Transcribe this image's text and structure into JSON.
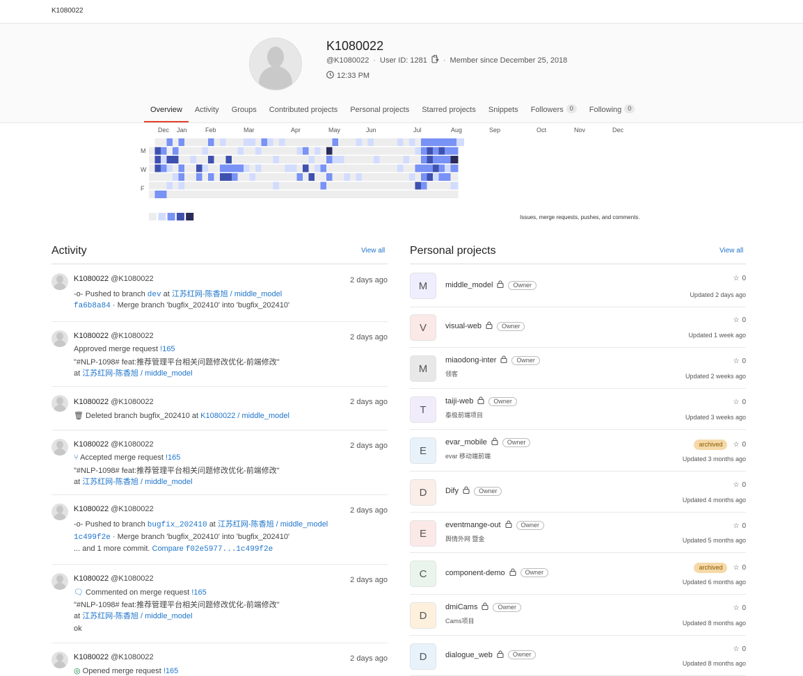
{
  "topbar": {
    "crumb": "K1080022"
  },
  "profile": {
    "name": "K1080022",
    "handle": "@K1080022",
    "user_id": "User ID: 1281",
    "member_since": "Member since December 25, 2018",
    "local_time": "12:33 PM"
  },
  "tabs": [
    {
      "label": "Overview"
    },
    {
      "label": "Activity"
    },
    {
      "label": "Groups"
    },
    {
      "label": "Contributed projects"
    },
    {
      "label": "Personal projects"
    },
    {
      "label": "Starred projects"
    },
    {
      "label": "Snippets"
    },
    {
      "label": "Followers",
      "count": "0"
    },
    {
      "label": "Following",
      "count": "0"
    }
  ],
  "calendar": {
    "months": [
      "Dec",
      "Jan",
      "Feb",
      "Mar",
      "Apr",
      "May",
      "Jun",
      "Jul",
      "Aug",
      "Sep",
      "Oct",
      "Nov",
      "Dec"
    ],
    "days": [
      "M",
      "W",
      "F"
    ],
    "note": "Issues, merge requests, pushes, and comments.",
    "colors": [
      "#ededed",
      "#d2dcff",
      "#7992f5",
      "#3f51ae",
      "#2a2b59"
    ]
  },
  "activity": {
    "title": "Activity",
    "view_all": "View all",
    "items": [
      {
        "author": "K1080022",
        "handle": "@K1080022",
        "time": "2 days ago",
        "l1_pre": "-o- Pushed to branch",
        "l1_branch": "dev",
        "l1_mid": "at",
        "l1_proj": "江苏红网-陈香旭 / middle_model",
        "l2_sha": "fa6b8a84",
        "l2_text": "· Merge branch 'bugfix_202410' into 'bugfix_202410'"
      },
      {
        "author": "K1080022",
        "handle": "@K1080022",
        "time": "2 days ago",
        "l1_pre": "Approved merge request",
        "l1_mr": "!165",
        "l2_text": "\"#NLP-1098# feat:推荐管理平台相关问题修改优化-前端修改\"",
        "l3_pre": "at",
        "l3_proj": "江苏红网-陈香旭 / middle_model"
      },
      {
        "author": "K1080022",
        "handle": "@K1080022",
        "time": "2 days ago",
        "l1_pre": "Deleted branch bugfix_202410 at",
        "l1_proj": "K1080022 / middle_model"
      },
      {
        "author": "K1080022",
        "handle": "@K1080022",
        "time": "2 days ago",
        "l1_pre": "Accepted merge request",
        "l1_mr": "!165",
        "l2_text": "\"#NLP-1098# feat:推荐管理平台相关问题修改优化-前端修改\"",
        "l3_pre": "at",
        "l3_proj": "江苏红网-陈香旭 / middle_model"
      },
      {
        "author": "K1080022",
        "handle": "@K1080022",
        "time": "2 days ago",
        "l1_pre": "-o- Pushed to branch",
        "l1_branch": "bugfix_202410",
        "l1_mid": "at",
        "l1_proj": "江苏红网-陈香旭 / middle_model",
        "l2_sha": "1c499f2e",
        "l2_text": "· Merge branch 'bugfix_202410' into 'bugfix_202410'",
        "l3_pre": "... and 1 more commit.",
        "l3_link": "Compare",
        "l3_code": "f02e5977...1c499f2e"
      },
      {
        "author": "K1080022",
        "handle": "@K1080022",
        "time": "2 days ago",
        "l1_pre": "Commented on merge request",
        "l1_mr": "!165",
        "l2_text": "\"#NLP-1098# feat:推荐管理平台相关问题修改优化-前端修改\"",
        "l3_pre": "at",
        "l3_proj": "江苏红网-陈香旭 / middle_model",
        "l4_text": "ok"
      },
      {
        "author": "K1080022",
        "handle": "@K1080022",
        "time": "2 days ago",
        "l1_pre": "Opened merge request",
        "l1_mr": "!165"
      }
    ]
  },
  "projects": {
    "title": "Personal projects",
    "view_all": "View all",
    "owner_label": "Owner",
    "archived_label": "archived",
    "items": [
      {
        "letter": "M",
        "name": "middle_model",
        "desc": "",
        "stars": "0",
        "updated": "Updated 2 days ago",
        "archived": false,
        "color": "#eeeeff"
      },
      {
        "letter": "V",
        "name": "visual-web",
        "desc": "",
        "stars": "0",
        "updated": "Updated 1 week ago",
        "archived": false,
        "color": "#fbe9e7"
      },
      {
        "letter": "M",
        "name": "miaodong-inter",
        "desc": "领客",
        "stars": "0",
        "updated": "Updated 2 weeks ago",
        "archived": false,
        "color": "#e8e8e8"
      },
      {
        "letter": "T",
        "name": "taiji-web",
        "desc": "泰极前端项目",
        "stars": "0",
        "updated": "Updated 3 weeks ago",
        "archived": false,
        "color": "#f1ecfc"
      },
      {
        "letter": "E",
        "name": "evar_mobile",
        "desc": "evar 移动端前端",
        "stars": "0",
        "updated": "Updated 3 months ago",
        "archived": true,
        "color": "#e8f2fb"
      },
      {
        "letter": "D",
        "name": "Dify",
        "desc": "",
        "stars": "0",
        "updated": "Updated 4 months ago",
        "archived": false,
        "color": "#fbeee8"
      },
      {
        "letter": "E",
        "name": "eventmange-out",
        "desc": "舆情外网 暨金",
        "stars": "0",
        "updated": "Updated 5 months ago",
        "archived": false,
        "color": "#fbe9e7"
      },
      {
        "letter": "C",
        "name": "component-demo",
        "desc": "",
        "stars": "0",
        "updated": "Updated 6 months ago",
        "archived": true,
        "color": "#e9f5ec"
      },
      {
        "letter": "D",
        "name": "dmiCams",
        "desc": "Cams项目",
        "stars": "0",
        "updated": "Updated 8 months ago",
        "archived": false,
        "color": "#fdf1dd"
      },
      {
        "letter": "D",
        "name": "dialogue_web",
        "desc": "",
        "stars": "0",
        "updated": "Updated 8 months ago",
        "archived": false,
        "color": "#e8f2fb"
      }
    ]
  }
}
